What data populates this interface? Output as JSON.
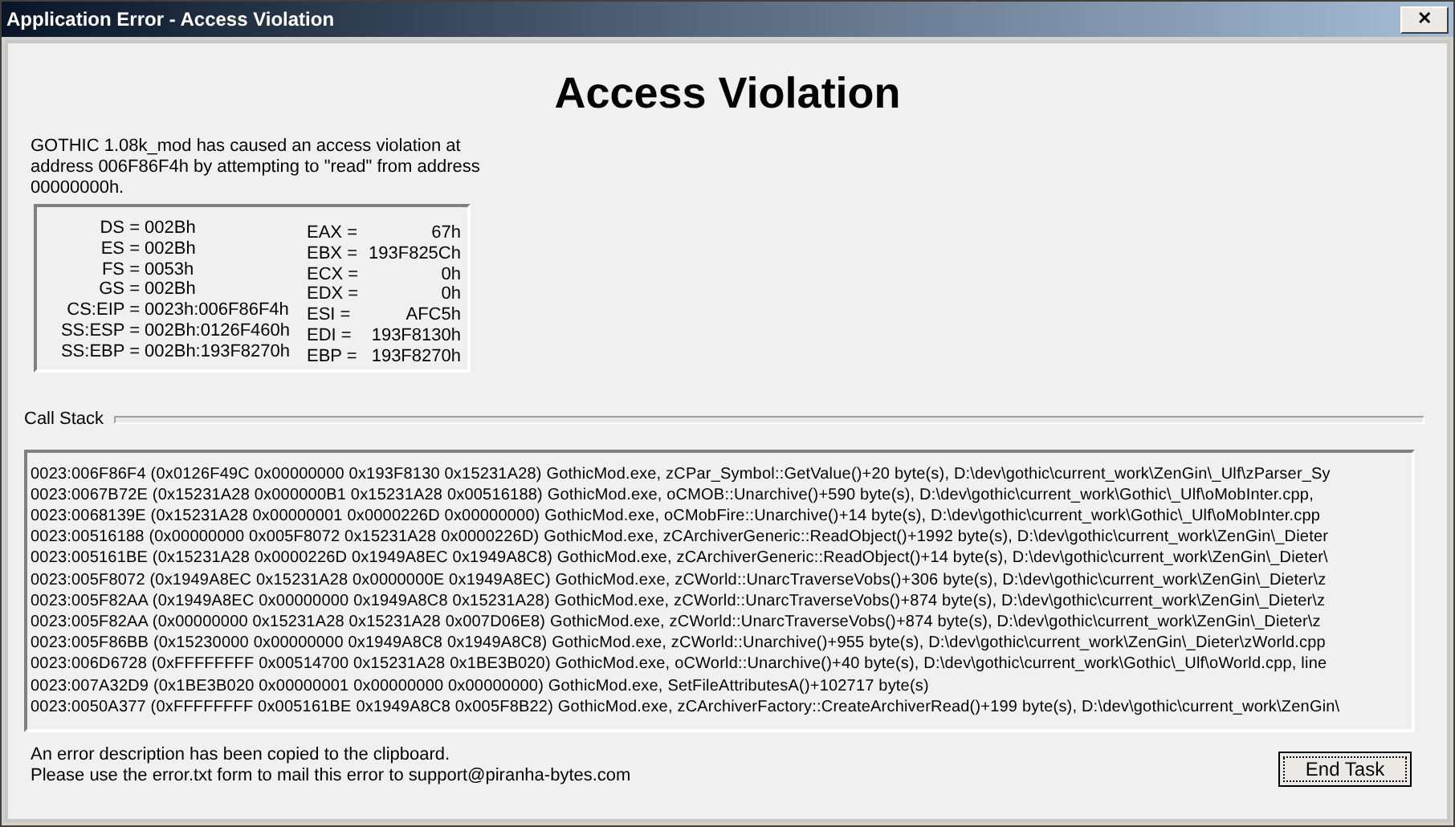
{
  "window": {
    "title": "Application Error - Access Violation",
    "close": "✕"
  },
  "heading": "Access Violation",
  "message": "GOTHIC 1.08k_mod has caused an access violation at address 006F86F4h by attempting to \"read\" from address 00000000h.",
  "registers_left": [
    {
      "label": "DS =",
      "value": "002Bh"
    },
    {
      "label": "ES =",
      "value": "002Bh"
    },
    {
      "label": "FS =",
      "value": "0053h"
    },
    {
      "label": "GS =",
      "value": "002Bh"
    },
    {
      "label": "CS:EIP =",
      "value": "0023h:006F86F4h"
    },
    {
      "label": "SS:ESP =",
      "value": "002Bh:0126F460h"
    },
    {
      "label": "SS:EBP =",
      "value": "002Bh:193F8270h"
    }
  ],
  "registers_right": [
    {
      "label": "EAX =",
      "value": "67h"
    },
    {
      "label": "EBX =",
      "value": "193F825Ch"
    },
    {
      "label": "ECX =",
      "value": "0h"
    },
    {
      "label": "EDX =",
      "value": "0h"
    },
    {
      "label": "ESI =",
      "value": "AFC5h"
    },
    {
      "label": "EDI =",
      "value": "193F8130h"
    },
    {
      "label": "EBP =",
      "value": "193F8270h"
    }
  ],
  "call_stack": {
    "label": "Call Stack",
    "lines": [
      "0023:006F86F4 (0x0126F49C 0x00000000 0x193F8130 0x15231A28) GothicMod.exe, zCPar_Symbol::GetValue()+20 byte(s), D:\\dev\\gothic\\current_work\\ZenGin\\_Ulf\\zParser_Sy",
      "0023:0067B72E (0x15231A28 0x000000B1 0x15231A28 0x00516188) GothicMod.exe, oCMOB::Unarchive()+590 byte(s), D:\\dev\\gothic\\current_work\\Gothic\\_Ulf\\oMobInter.cpp,",
      "0023:0068139E (0x15231A28 0x00000001 0x0000226D 0x00000000) GothicMod.exe, oCMobFire::Unarchive()+14 byte(s), D:\\dev\\gothic\\current_work\\Gothic\\_Ulf\\oMobInter.cpp",
      "0023:00516188 (0x00000000 0x005F8072 0x15231A28 0x0000226D) GothicMod.exe, zCArchiverGeneric::ReadObject()+1992 byte(s), D:\\dev\\gothic\\current_work\\ZenGin\\_Dieter",
      "0023:005161BE (0x15231A28 0x0000226D 0x1949A8EC 0x1949A8C8) GothicMod.exe, zCArchiverGeneric::ReadObject()+14 byte(s), D:\\dev\\gothic\\current_work\\ZenGin\\_Dieter\\",
      "0023:005F8072 (0x1949A8EC 0x15231A28 0x0000000E 0x1949A8EC) GothicMod.exe, zCWorld::UnarcTraverseVobs()+306 byte(s), D:\\dev\\gothic\\current_work\\ZenGin\\_Dieter\\z",
      "0023:005F82AA (0x1949A8EC 0x00000000 0x1949A8C8 0x15231A28) GothicMod.exe, zCWorld::UnarcTraverseVobs()+874 byte(s), D:\\dev\\gothic\\current_work\\ZenGin\\_Dieter\\z",
      "0023:005F82AA (0x00000000 0x15231A28 0x15231A28 0x007D06E8) GothicMod.exe, zCWorld::UnarcTraverseVobs()+874 byte(s), D:\\dev\\gothic\\current_work\\ZenGin\\_Dieter\\z",
      "0023:005F86BB (0x15230000 0x00000000 0x1949A8C8 0x1949A8C8) GothicMod.exe, zCWorld::Unarchive()+955 byte(s), D:\\dev\\gothic\\current_work\\ZenGin\\_Dieter\\zWorld.cpp",
      "0023:006D6728 (0xFFFFFFFF 0x00514700 0x15231A28 0x1BE3B020) GothicMod.exe, oCWorld::Unarchive()+40 byte(s), D:\\dev\\gothic\\current_work\\Gothic\\_Ulf\\oWorld.cpp, line",
      "0023:007A32D9 (0x1BE3B020 0x00000001 0x00000000 0x00000000) GothicMod.exe, SetFileAttributesA()+102717 byte(s)",
      "0023:0050A377 (0xFFFFFFFF 0x005161BE 0x1949A8C8 0x005F8B22) GothicMod.exe, zCArchiverFactory::CreateArchiverRead()+199 byte(s), D:\\dev\\gothic\\current_work\\ZenGin\\"
    ]
  },
  "footer": [
    "An error description has been copied to the clipboard.",
    "Please use the error.txt form to mail this error to support@piranha-bytes.com"
  ],
  "buttons": [
    "End Task"
  ]
}
